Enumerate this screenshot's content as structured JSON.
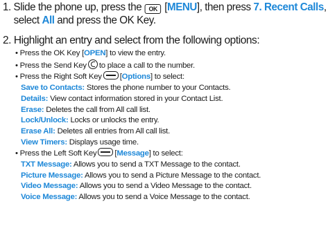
{
  "step1": {
    "number": "1.",
    "text_a": "Slide the phone up, press the",
    "ok_key_glyph": "OK",
    "ok_key_icon": "ok-key-icon",
    "open_bracket": " [",
    "menu_label": "MENU",
    "text_b": "], then press",
    "recent_calls": "7. Recent Calls",
    "comma": ",",
    "text_c": "select",
    "all_label": "All",
    "text_d": "and press the OK Key."
  },
  "step2": {
    "number": "2.",
    "text": "Highlight an entry and select from the following options:",
    "bullets": [
      {
        "prefix": "• Press the OK Key [",
        "label": "OPEN",
        "suffix": "] to view the entry."
      },
      {
        "prefix": "• Press the Send Key",
        "icon": "send-key-icon",
        "suffix": "to place a call to the number."
      },
      {
        "prefix": "• Press the Right Soft Key",
        "icon": "right-soft-key-icon",
        "open": "[",
        "label": "Options",
        "suffix": "] to select:"
      },
      {
        "prefix": "• Press the Left Soft Key",
        "icon": "left-soft-key-icon",
        "open": "[",
        "label": "Message",
        "suffix": "] to select:"
      }
    ],
    "options_items": [
      {
        "term": "Save to Contacts:",
        "desc": "Stores the phone number to your Contacts."
      },
      {
        "term": "Details:",
        "desc": "View contact information stored in your Contact List."
      },
      {
        "term": "Erase:",
        "desc": "Deletes the call from All call list."
      },
      {
        "term": "Lock/Unlock:",
        "desc": "Locks or unlocks the entry."
      },
      {
        "term": "Erase All:",
        "desc": "Deletes all entries from All call list."
      },
      {
        "term": "View Timers:",
        "desc": "Displays usage time."
      }
    ],
    "message_items": [
      {
        "term": "TXT Message:",
        "desc": "Allows you to send a TXT Message to the contact."
      },
      {
        "term": "Picture Message:",
        "desc": "Allows you to send a Picture Message to the contact."
      },
      {
        "term": "Video Message:",
        "desc": "Allows you to send a Video Message to the contact."
      },
      {
        "term": "Voice Message:",
        "desc": "Allows you to send a Voice Message to the contact."
      }
    ]
  },
  "colors": {
    "accent": "#1e88d8",
    "text": "#1a1a1a"
  }
}
